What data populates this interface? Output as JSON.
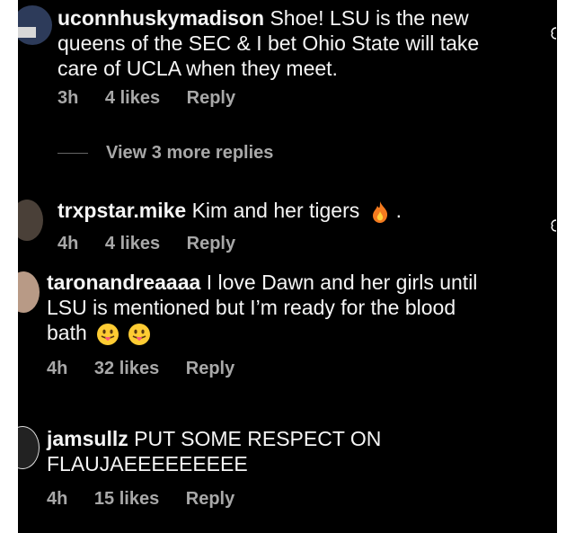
{
  "comments": [
    {
      "username": "uconnhuskymadison",
      "text": "Shoe! LSU is the new queens of the SEC & I bet Ohio State will take care of UCLA when they meet.",
      "lines": [
        "Shoe! LSU is the new",
        "queens of the SEC & I bet Ohio State will take",
        "care of UCLA when they meet."
      ],
      "time": "3h",
      "likes": "4 likes",
      "reply": "Reply"
    },
    {
      "username": "trxpstar.mike",
      "text": "Kim and her tigers",
      "after_emoji": ".",
      "emoji": "fire",
      "time": "4h",
      "likes": "4 likes",
      "reply": "Reply"
    },
    {
      "username": "taronandreaaaa",
      "lines": [
        "I love Dawn and her girls until",
        "LSU is mentioned but I’m ready for the blood",
        "bath"
      ],
      "emojis": [
        "tongue-face",
        "tongue-face"
      ],
      "time": "4h",
      "likes": "32 likes",
      "reply": "Reply"
    },
    {
      "username": "jamsullz",
      "lines": [
        "PUT SOME RESPECT ON",
        "FLAUJAEEEEEEEEE"
      ],
      "time": "4h",
      "likes": "15 likes",
      "reply": "Reply"
    }
  ],
  "view_more": "View 3 more replies",
  "colors": {
    "background": "#000000",
    "text": "#f5f5f5",
    "muted": "#a8a8a8",
    "frame": "#ffffff"
  }
}
